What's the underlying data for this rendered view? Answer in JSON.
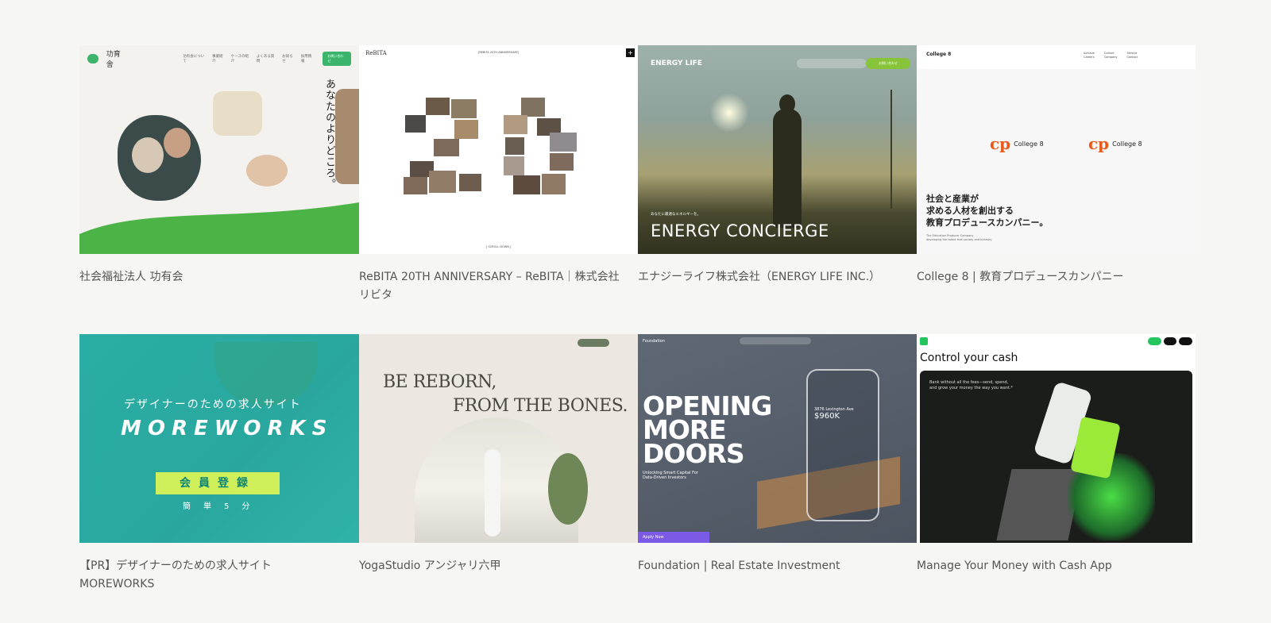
{
  "cards": [
    {
      "caption": "社会福祉法人 功有会",
      "shot": {
        "logo": "功育舎",
        "nav": [
          "功有会について",
          "事業紹介",
          "ケースの紹介",
          "よくある質問",
          "お知らせ",
          "採用情報"
        ],
        "cta": "お問い合わせ",
        "headline": "あなたのよりどころ。",
        "accent": "#3cb46b"
      }
    },
    {
      "caption": "ReBITA 20TH ANNIVERSARY – ReBITA｜株式会社リビタ",
      "shot": {
        "logo": "ReBITA",
        "top": "[REBITA 20TH ANNIVERSARY]",
        "scroll": "[ SCROLL DOWN ]",
        "number": "20"
      }
    },
    {
      "caption": "エナジーライフ株式会社（ENERGY LIFE INC.）",
      "shot": {
        "logo": "ENERGY LIFE",
        "small": "あなたに最適なエネルギーを。",
        "headline": "ENERGY CONCIERGE",
        "cta": "お問い合わせ",
        "accent": "#88c43a"
      }
    },
    {
      "caption": "College 8 | 教育プロデュースカンパニー",
      "shot": {
        "logo": "College 8",
        "nav": [
          "Achieve",
          "Culture",
          "Service",
          "Careers",
          "Company",
          "Contact"
        ],
        "mark": "College 8",
        "headline_lines": [
          "社会と産業が",
          "求める人材を創出する",
          "教育プロデュースカンパニー。"
        ],
        "sub_lines": [
          "The Education Producer Company",
          "developing the talent that society and industry"
        ],
        "accent": "#ea5a1a"
      }
    },
    {
      "caption": "【PR】デザイナーのための求人サイト MOREWORKS",
      "shot": {
        "tagline": "デザイナーのための求人サイト",
        "logo": "MOREWORKS",
        "button": "会員登録",
        "easy": "簡単5分",
        "accent": "#cff05a"
      }
    },
    {
      "caption": "YogaStudio アンジャリ六甲",
      "shot": {
        "line1": "BE REBORN,",
        "line2": "FROM THE BONES."
      }
    },
    {
      "caption": "Foundation | Real Estate Investment",
      "shot": {
        "logo": "Foundation",
        "headline_lines": [
          "OPENING",
          "MORE",
          "DOORS"
        ],
        "sub_lines": [
          "Unlocking Smart Capital For",
          "Data-Driven Investors"
        ],
        "address": "3876 Lexington Ave",
        "price": "$960K",
        "apply": "Apply Now",
        "accent": "#7b5ae6"
      }
    },
    {
      "caption": "Manage Your Money with Cash App",
      "shot": {
        "title": "Control your cash",
        "body_lines": [
          "Bank without all the fees—send, spend,",
          "and grow your money the way you want.*"
        ],
        "accent": "#22c55e"
      }
    }
  ]
}
